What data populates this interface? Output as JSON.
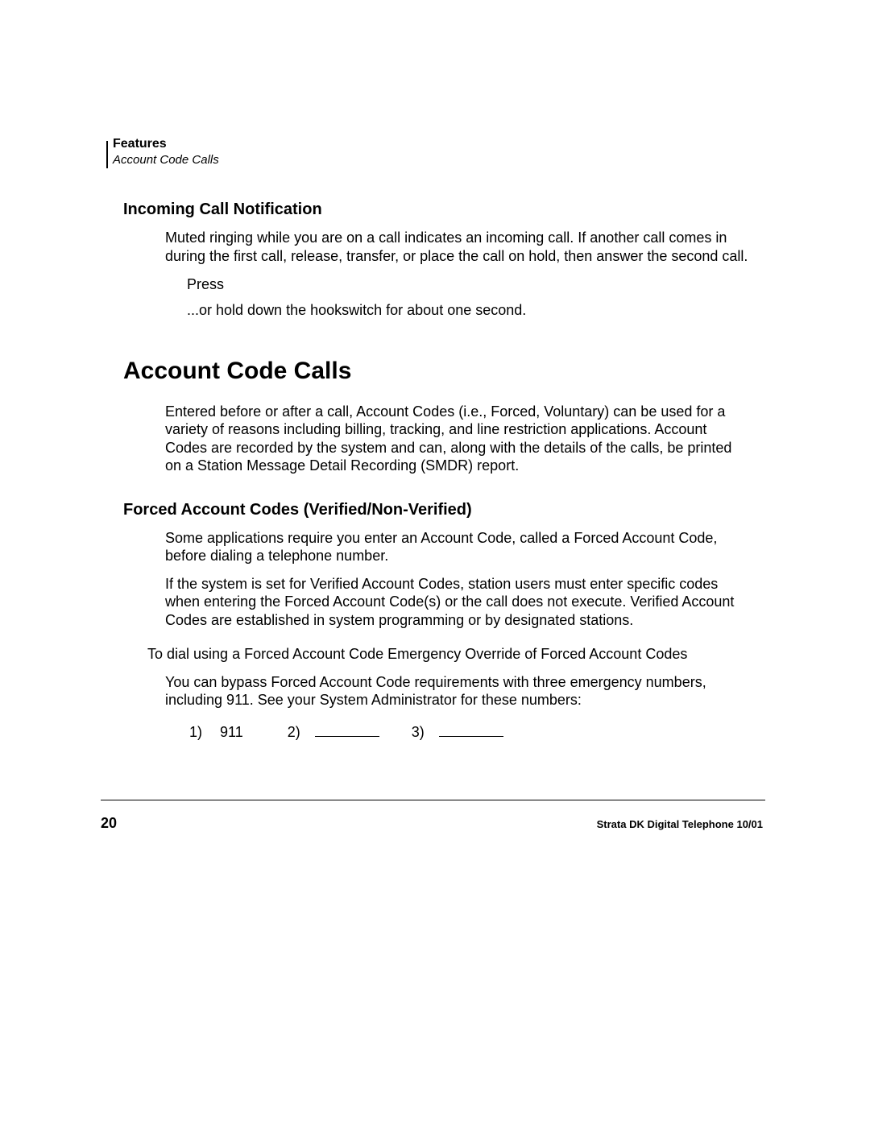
{
  "header": {
    "section": "Features",
    "topic": "Account Code Calls"
  },
  "incoming": {
    "title": "Incoming Call Notification",
    "p1": "Muted ringing while you are on a call indicates an incoming call. If another call comes in during the first call, release, transfer, or place the call on hold, then answer the second call.",
    "press": "Press",
    "orhold": "...or hold down the hookswitch for about one second."
  },
  "account": {
    "title": "Account Code Calls",
    "p1": "Entered before or after a call, Account Codes (i.e., Forced, Voluntary) can be used for a variety of reasons including billing, tracking, and line restriction applications. Account Codes are recorded by the system and can, along with the details of the calls, be printed on a Station Message Detail Recording (SMDR) report."
  },
  "forced": {
    "title": "Forced Account Codes (Verified/Non-Verified)",
    "p1": "Some applications require you enter an Account Code, called a Forced Account Code, before dialing a telephone number.",
    "p2": "If the system is set for Verified Account Codes, station users must enter specific codes when entering the Forced Account Code(s) or the call does not execute. Verified Account Codes are established in system programming or by designated stations.",
    "todial": "To dial using a Forced Account Code Emergency Override of Forced Account Codes",
    "bypass": "You can bypass Forced Account Code requirements with three emergency numbers, including 911. See your System Administrator for these numbers:",
    "e1_label": "1)",
    "e1_value": "911",
    "e2_label": "2)",
    "e3_label": "3)"
  },
  "footer": {
    "page": "20",
    "doc": "Strata DK Digital Telephone   10/01"
  }
}
